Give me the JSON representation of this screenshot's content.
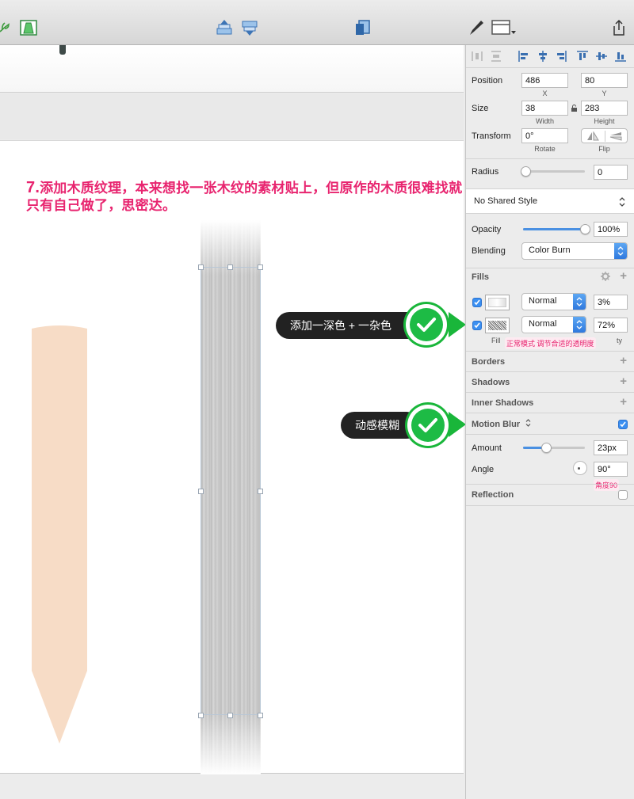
{
  "toolbar": {
    "icons": [
      "leaf-icon",
      "mask-shape-icon",
      "move-forward-icon",
      "move-backward-icon",
      "mirror-icon",
      "pen-icon",
      "view-icon",
      "share-icon"
    ]
  },
  "canvas": {
    "headline_num": "7.",
    "headline_text": "添加木质纹理，本来想找一张木纹的素材贴上，但原作的木质很难找就只有自己做了，思密达。",
    "callout_noise": "添加一深色 + 一杂色",
    "callout_blur": "动感模糊"
  },
  "inspector": {
    "position": {
      "label": "Position",
      "x": "486",
      "y": "80",
      "x_label": "X",
      "y_label": "Y"
    },
    "size": {
      "label": "Size",
      "width": "38",
      "height": "283",
      "w_label": "Width",
      "h_label": "Height"
    },
    "transform": {
      "label": "Transform",
      "rotate": "0°",
      "rotate_label": "Rotate",
      "flip_label": "Flip"
    },
    "radius": {
      "label": "Radius",
      "value": "0",
      "slider": 0
    },
    "shared_style": "No Shared Style",
    "opacity": {
      "label": "Opacity",
      "value": "100%",
      "slider": 1.0
    },
    "blending": {
      "label": "Blending",
      "value": "Color Burn"
    },
    "fills": {
      "title": "Fills",
      "items": [
        {
          "enabled": true,
          "mode": "Normal",
          "opacity": "3%"
        },
        {
          "enabled": true,
          "mode": "Normal",
          "opacity": "72%"
        }
      ],
      "fill_label": "Fill",
      "fill_label_tail": "ty",
      "note": "正常模式  调节合适的透明度"
    },
    "borders": "Borders",
    "shadows": "Shadows",
    "inner_shadows": "Inner Shadows",
    "motion_blur": {
      "title": "Motion Blur",
      "enabled": true,
      "amount_label": "Amount",
      "amount": "23px",
      "amount_slider": 0.37,
      "angle_label": "Angle",
      "angle": "90°",
      "note": "角度90"
    },
    "reflection": {
      "title": "Reflection",
      "enabled": false
    }
  },
  "colors": {
    "accent": "#3a8ff1",
    "annotation": "#e8246f",
    "check_green": "#1dbb45",
    "pencil": "#f7dcc6"
  }
}
